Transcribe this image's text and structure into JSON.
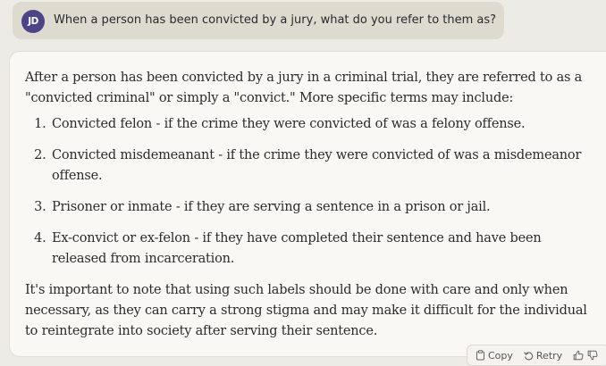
{
  "user_message": {
    "avatar_initials": "JD",
    "text": "When a person has been convicted by a jury, what do you refer to them as?"
  },
  "response": {
    "intro": "After a person has been convicted by a jury in a criminal trial, they are referred to as a \"convicted criminal\" or simply a \"convict.\" More specific terms may include:",
    "items": [
      "Convicted felon - if the crime they were convicted of was a felony offense.",
      "Convicted misdemeanant - if the crime they were convicted of was a misdemeanor offense.",
      "Prisoner or inmate - if they are serving a sentence in a prison or jail.",
      "Ex-convict or ex-felon - if they have completed their sentence and have been released from incarceration."
    ],
    "closing": "It's important to note that using such labels should be done with care and only when necessary, as they can carry a strong stigma and may make it difficult for the individual to reintegrate into society after serving their sentence."
  },
  "actions": {
    "copy_label": "Copy",
    "retry_label": "Retry",
    "copy_icon": "clipboard-icon",
    "retry_icon": "retry-arrow-icon",
    "thumbs_up_icon": "thumbs-up-icon",
    "thumbs_down_icon": "thumbs-down-icon"
  },
  "colors": {
    "avatar_bg": "#4c4486",
    "user_bubble_bg": "#dedad0",
    "page_bg": "#ecebe5",
    "card_bg": "#f9f8f5"
  }
}
